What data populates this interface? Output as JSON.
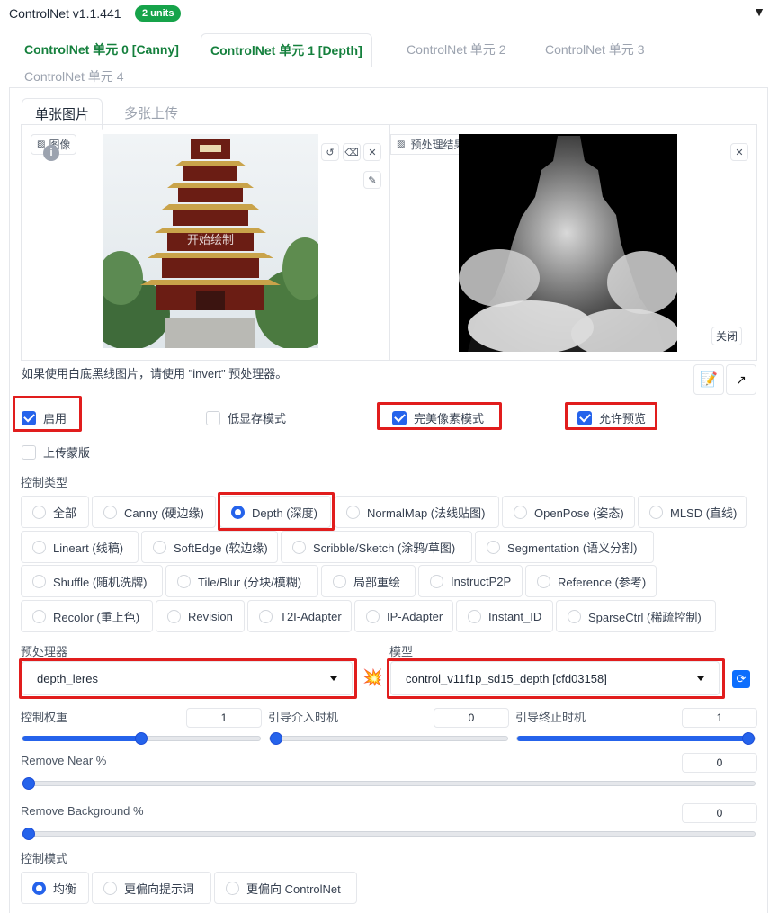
{
  "header": {
    "title": "ControlNet v1.1.441",
    "badge": "2 units",
    "collapse_icon": "▼"
  },
  "unit_tabs": [
    {
      "label": "ControlNet 单元 0 [Canny]"
    },
    {
      "label": "ControlNet 单元 1 [Depth]"
    },
    {
      "label": "ControlNet 单元 2"
    },
    {
      "label": "ControlNet 单元 3"
    },
    {
      "label": "ControlNet 单元 4"
    }
  ],
  "image_tabs": [
    {
      "label": "单张图片"
    },
    {
      "label": "多张上传"
    }
  ],
  "input_image": {
    "label": "图像",
    "watermark": "开始绘制"
  },
  "preview_image": {
    "label": "预处理结果预览",
    "close_label": "关闭"
  },
  "hint": "如果使用白底黑线图片，请使用 \"invert\" 预处理器。",
  "checkboxes": {
    "enable": {
      "label": "启用",
      "checked": true
    },
    "low_vram": {
      "label": "低显存模式",
      "checked": false
    },
    "pixel_perfect": {
      "label": "完美像素模式",
      "checked": true
    },
    "allow_preview": {
      "label": "允许预览",
      "checked": true
    },
    "upload_mask": {
      "label": "上传蒙版",
      "checked": false
    }
  },
  "control_type": {
    "label": "控制类型",
    "options": [
      "全部",
      "Canny (硬边缘)",
      "Depth (深度)",
      "NormalMap (法线贴图)",
      "OpenPose (姿态)",
      "MLSD (直线)",
      "Lineart (线稿)",
      "SoftEdge (软边缘)",
      "Scribble/Sketch (涂鸦/草图)",
      "Segmentation (语义分割)",
      "Shuffle (随机洗牌)",
      "Tile/Blur (分块/模糊)",
      "局部重绘",
      "InstructP2P",
      "Reference (参考)",
      "Recolor (重上色)",
      "Revision",
      "T2I-Adapter",
      "IP-Adapter",
      "Instant_ID",
      "SparseCtrl (稀疏控制)"
    ],
    "selected": "Depth (深度)"
  },
  "preprocessor": {
    "label": "预处理器",
    "value": "depth_leres"
  },
  "model": {
    "label": "模型",
    "value": "control_v11f1p_sd15_depth [cfd03158]"
  },
  "sliders": {
    "weight": {
      "label": "控制权重",
      "value": "1",
      "fraction": 0.5
    },
    "start": {
      "label": "引导介入时机",
      "value": "0",
      "fraction": 0.0
    },
    "end": {
      "label": "引导终止时机",
      "value": "1",
      "fraction": 1.0
    },
    "remove_near": {
      "label": "Remove Near %",
      "value": "0",
      "fraction": 0.0
    },
    "remove_bg": {
      "label": "Remove Background %",
      "value": "0",
      "fraction": 0.0
    }
  },
  "control_mode": {
    "label": "控制模式",
    "options": [
      "均衡",
      "更偏向提示词",
      "更偏向 ControlNet"
    ],
    "selected": "均衡"
  },
  "colors": {
    "accent": "#2563eb",
    "green": "#16a34a",
    "highlight": "#e11d1d"
  }
}
